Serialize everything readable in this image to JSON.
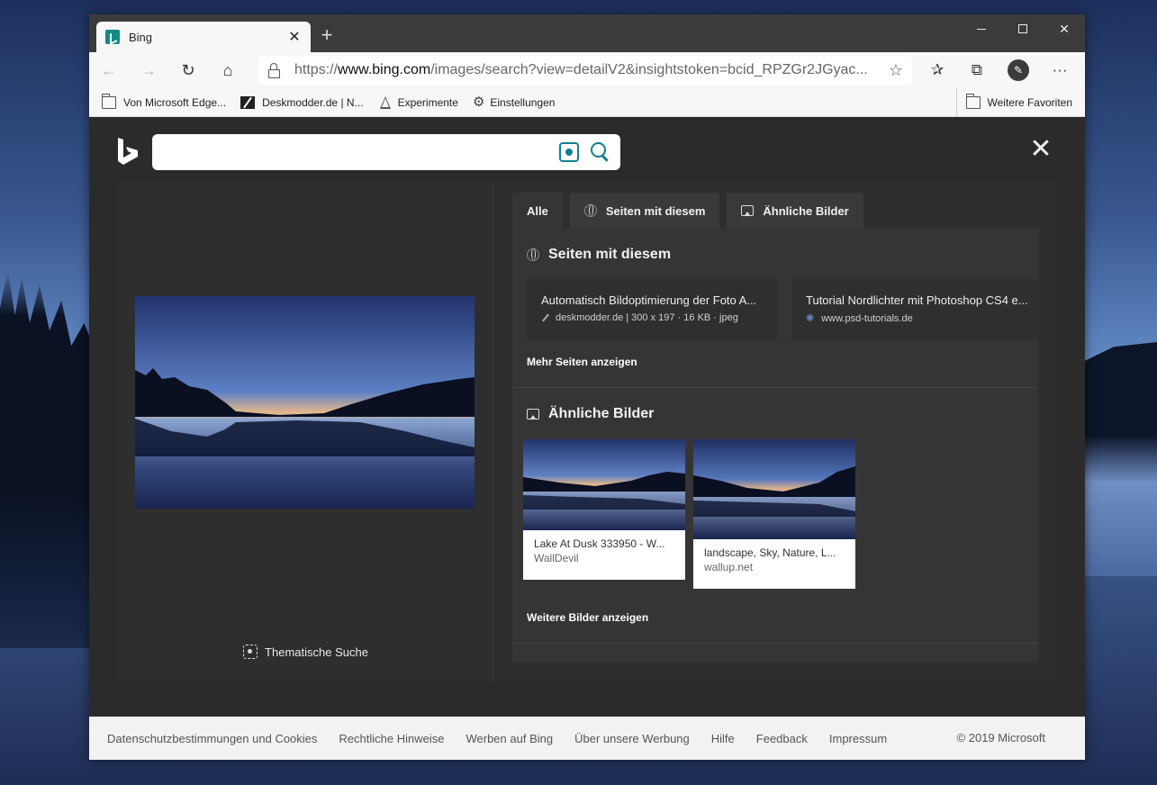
{
  "browser": {
    "tab": {
      "title": "Bing",
      "close_glyph": "✕"
    },
    "new_tab_glyph": "+",
    "window_controls": {
      "close_glyph": "✕"
    },
    "nav": {
      "back_glyph": "←",
      "forward_glyph": "→",
      "refresh_glyph": "↻",
      "home_glyph": "⌂"
    },
    "address": {
      "scheme": "https://",
      "host": "www.bing.com",
      "path": "/images/search?view=detailV2&insightstoken=bcid_RPZGr2JGyac..."
    },
    "toolbar": {
      "favorite_glyph": "☆",
      "favorites_glyph": "✰",
      "collections_glyph": "⧉",
      "more_glyph": "···"
    },
    "favorites": [
      {
        "label": "Von Microsoft Edge...",
        "icon": "folder-icon"
      },
      {
        "label": "Deskmodder.de | N...",
        "icon": "deskmodder-icon"
      },
      {
        "label": "Experimente",
        "icon": "flask-icon"
      },
      {
        "label": "Einstellungen",
        "icon": "gear-icon"
      }
    ],
    "other_favorites": "Weitere Favoriten"
  },
  "bing": {
    "search_value": "",
    "close_glyph": "✕",
    "thematic_search": "Thematische Suche",
    "tabs": [
      {
        "label": "Alle",
        "icon": ""
      },
      {
        "label": "Seiten mit diesem",
        "icon": "globe-icon"
      },
      {
        "label": "Ähnliche Bilder",
        "icon": "image-icon"
      }
    ],
    "pages_section": {
      "heading": "Seiten mit diesem",
      "cards": [
        {
          "title": "Automatisch Bildoptimierung der Foto A...",
          "meta": "deskmodder.de | 300 x 197 · 16 KB · jpeg"
        },
        {
          "title": "Tutorial Nordlichter mit Photoshop CS4 e...",
          "meta": "www.psd-tutorials.de"
        }
      ],
      "more": "Mehr Seiten anzeigen"
    },
    "similar_section": {
      "heading": "Ähnliche Bilder",
      "cards": [
        {
          "title": "Lake At Dusk 333950 - W...",
          "source": "WallDevil"
        },
        {
          "title": "landscape, Sky, Nature, L...",
          "source": "wallup.net"
        }
      ],
      "more": "Weitere Bilder anzeigen"
    }
  },
  "footer": {
    "links": [
      "Datenschutzbestimmungen und Cookies",
      "Rechtliche Hinweise",
      "Werben auf Bing",
      "Über unsere Werbung",
      "Hilfe",
      "Feedback",
      "Impressum"
    ],
    "copyright": "© 2019 Microsoft"
  },
  "colors": {
    "bing_teal": "#0f7f8f",
    "panel_dark": "#353535",
    "page_dark": "#2b2b2b"
  }
}
